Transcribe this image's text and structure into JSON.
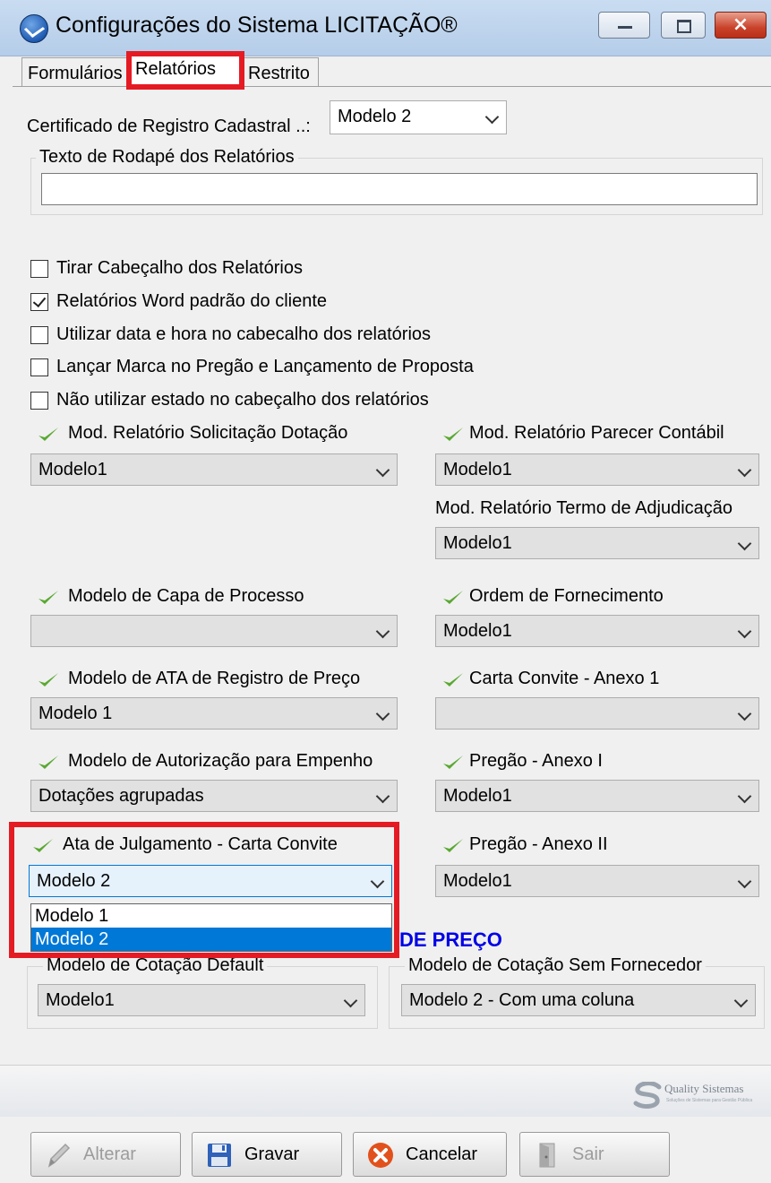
{
  "window": {
    "title": "Configurações do Sistema LICITAÇÃO®",
    "controls": {
      "minimize": "minimize-icon",
      "maximize": "maximize-icon",
      "close": "×"
    }
  },
  "tabs": [
    {
      "label": "Formulários",
      "active": false
    },
    {
      "label": "Relatórios",
      "active": true
    },
    {
      "label": "Restrito",
      "active": false
    }
  ],
  "certificado": {
    "label": "Certificado de Registro Cadastral ..:",
    "value": "Modelo 2"
  },
  "rodape": {
    "legend": "Texto de  Rodapé dos Relatórios",
    "value": ""
  },
  "checkboxes": [
    {
      "label": "Tirar Cabeçalho dos Relatórios",
      "checked": false
    },
    {
      "label": "Relatórios Word padrão do cliente",
      "checked": true
    },
    {
      "label": "Utilizar data e hora no cabecalho dos relatórios",
      "checked": false
    },
    {
      "label": "Lançar Marca no Pregão e Lançamento de Proposta",
      "checked": false
    },
    {
      "label": "Não utilizar estado no cabeçalho dos relatórios",
      "checked": false
    }
  ],
  "left_fields": {
    "solicitacao": {
      "label": "Mod. Relatório Solicitação Dotação",
      "value": "Modelo1"
    },
    "capa": {
      "label": "Modelo de Capa de Processo",
      "value": ""
    },
    "ata_registro": {
      "label": "Modelo de ATA de Registro de Preço",
      "value": "Modelo 1"
    },
    "autorizacao": {
      "label": "Modelo de Autorização para Empenho",
      "value": "Dotações agrupadas"
    },
    "ata_julgamento": {
      "label": "Ata de Julgamento - Carta Convite",
      "value": "Modelo 2",
      "options": [
        "Modelo 1",
        "Modelo 2"
      ]
    }
  },
  "right_fields": {
    "parecer": {
      "label": "Mod. Relatório Parecer Contábil",
      "value": "Modelo1"
    },
    "adjudicacao": {
      "label": "Mod. Relatório Termo de Adjudicação",
      "value": "Modelo1"
    },
    "fornecimento": {
      "label": "Ordem de Fornecimento",
      "value": "Modelo1"
    },
    "carta_anexo": {
      "label": "Carta Convite - Anexo 1",
      "value": ""
    },
    "pregao_anexo1": {
      "label": "Pregão - Anexo I",
      "value": "Modelo1"
    },
    "pregao_anexo2": {
      "label": "Pregão - Anexo II",
      "value": "Modelo1"
    }
  },
  "cotacao": {
    "section_title": "DE PREÇO",
    "default": {
      "legend": "Modelo de Cotação Default",
      "value": "Modelo1"
    },
    "sem_fornecedor": {
      "legend": "Modelo de Cotação Sem Fornecedor",
      "value": "Modelo 2 - Com uma coluna"
    }
  },
  "brand": {
    "name": "Quality Sistemas",
    "tagline": "Soluções de Sistemas para Gestão Pública"
  },
  "buttons": {
    "alterar": {
      "label": "Alterar",
      "icon": "pencil-icon",
      "enabled": false
    },
    "gravar": {
      "label": "Gravar",
      "icon": "floppy-disk-icon",
      "enabled": true
    },
    "cancelar": {
      "label": "Cancelar",
      "icon": "cancel-x-icon",
      "enabled": true
    },
    "sair": {
      "label": "Sair",
      "icon": "door-exit-icon",
      "enabled": false
    }
  },
  "colors": {
    "highlight_red": "#e51b24",
    "selection_blue": "#0078d7",
    "section_blue": "#0000e6",
    "check_green": "#5aa832"
  }
}
